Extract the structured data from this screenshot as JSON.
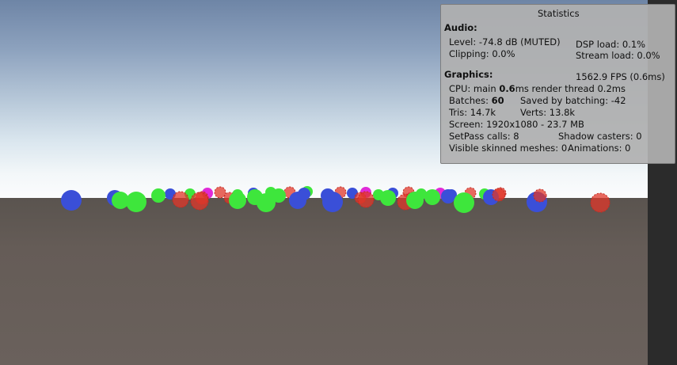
{
  "stats": {
    "title": "Statistics",
    "audio": {
      "heading": "Audio:",
      "level": "Level: -74.8 dB (MUTED)",
      "dsp_load": "DSP load: 0.1%",
      "clipping": "Clipping: 0.0%",
      "stream_load": "Stream load: 0.0%"
    },
    "graphics": {
      "heading": "Graphics:",
      "fps": "1562.9 FPS (0.6ms)",
      "cpu_prefix": "CPU: main ",
      "cpu_main_value": "0.6",
      "cpu_suffix": "ms  render thread 0.2ms",
      "batches_label": "Batches: ",
      "batches_value": "60",
      "saved_by_batching": "Saved by batching: -42",
      "tris": "Tris: 14.7k",
      "verts": "Verts: 13.8k",
      "screen": "Screen: 1920x1080 - 23.7 MB",
      "setpass": "SetPass calls: 8",
      "shadow_casters": "Shadow casters: 0",
      "skinned_meshes": "Visible skinned meshes: 0",
      "animations": "Animations: 0"
    }
  },
  "scene": {
    "colors": {
      "blue_sphere": "#3a4fd8",
      "green_sphere": "#3ee63c",
      "red_particles": "#e0372a",
      "magenta": "#e02ad8"
    }
  }
}
